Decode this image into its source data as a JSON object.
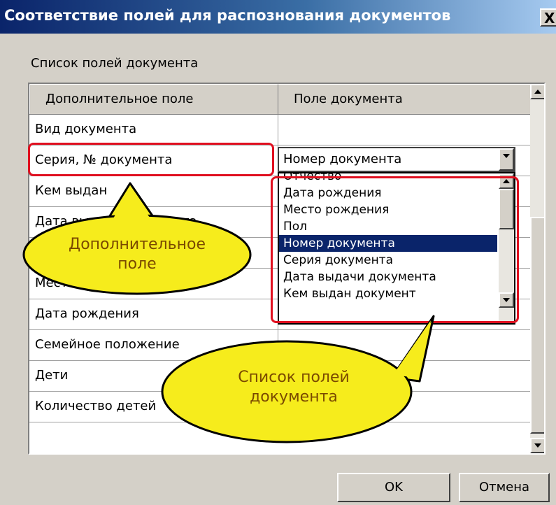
{
  "window": {
    "title": "Соответствие полей для распознования документов",
    "close_label": "X"
  },
  "group_label": "Список полей документа",
  "table": {
    "headers": [
      "Дополнительное поле",
      "Поле документа"
    ],
    "rows": [
      {
        "field": "Вид документа",
        "doc": ""
      },
      {
        "field": "Серия, № документа",
        "doc": "Номер документа"
      },
      {
        "field": "Кем выдан",
        "doc": ""
      },
      {
        "field": "Дата выдачи документа",
        "doc": ""
      },
      {
        "field": "",
        "doc": ""
      },
      {
        "field": "Место постоянного жит...",
        "doc": ""
      },
      {
        "field": "Дата рождения",
        "doc": ""
      },
      {
        "field": "Семейное положение",
        "doc": ""
      },
      {
        "field": "Дети",
        "doc": ""
      },
      {
        "field": "Количество детей",
        "doc": ""
      }
    ]
  },
  "combo": {
    "value": "Номер документа",
    "options": [
      "Отчество",
      "Дата рождения",
      "Место рождения",
      "Пол",
      "Номер документа",
      "Серия документа",
      "Дата выдачи документа",
      "Кем выдан документ"
    ],
    "selected_index": 4
  },
  "callouts": {
    "left": "Дополнительное поле",
    "left_line1": "Дополнительное",
    "left_line2": "поле",
    "right": "Список полей документа",
    "right_line1": "Список полей",
    "right_line2": "документа"
  },
  "buttons": {
    "ok": "OK",
    "cancel": "Отмена"
  },
  "colors": {
    "title_bar": "#0a246a",
    "highlight": "#e01020",
    "callout_fill": "#f6ec1c",
    "selection": "#0a246a"
  }
}
